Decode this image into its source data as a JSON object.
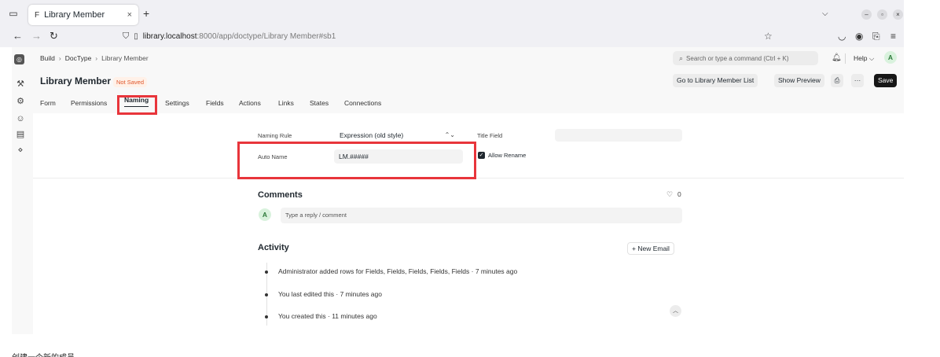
{
  "browser": {
    "tab_title": "Library Member",
    "tab_favicon": "F",
    "tab_close": "×",
    "new_tab": "+",
    "url_host": "library.localhost",
    "url_path": ":8000/app/doctype/Library Member#sb1"
  },
  "breadcrumb": [
    "Build",
    "DocType",
    "Library Member"
  ],
  "search": {
    "placeholder": "Search or type a command (Ctrl + K)"
  },
  "help_label": "Help",
  "user_initial": "A",
  "page": {
    "title": "Library Member",
    "status": "Not Saved"
  },
  "actions": {
    "go_to_list": "Go to Library Member List",
    "show_preview": "Show Preview",
    "more": "···",
    "save": "Save"
  },
  "tabs": [
    "Form",
    "Permissions",
    "Naming",
    "Settings",
    "Fields",
    "Actions",
    "Links",
    "States",
    "Connections"
  ],
  "active_tab": "Naming",
  "naming": {
    "naming_rule_label": "Naming Rule",
    "naming_rule_value": "Expression (old style)",
    "title_field_label": "Title Field",
    "auto_name_label": "Auto Name",
    "auto_name_value": "LM.#####",
    "allow_rename_label": "Allow Rename",
    "allow_rename_checked": true
  },
  "comments": {
    "heading": "Comments",
    "like_count": "0",
    "placeholder": "Type a reply / comment"
  },
  "activity": {
    "heading": "Activity",
    "new_email": "+ New Email",
    "items": [
      "Administrator added rows for Fields, Fields, Fields, Fields, Fields · 7 minutes ago",
      "You last edited this · 7 minutes ago",
      "You created this · 11 minutes ago"
    ]
  },
  "caption": "创建一个新的成员",
  "colors": {
    "highlight": "#e8353b",
    "status": "#e0562b",
    "primary_button": "#171717"
  }
}
